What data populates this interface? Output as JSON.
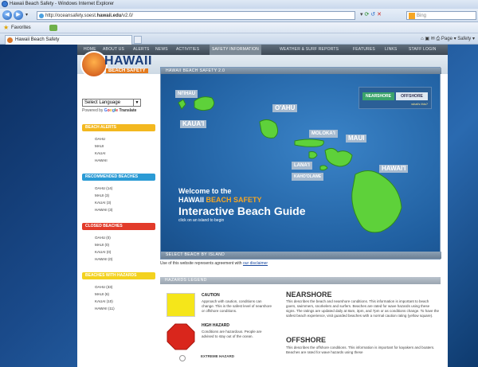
{
  "window": {
    "title": "Hawaii Beach Safety - Windows Internet Explorer",
    "url_prefix": "http://oceansafety.soest.",
    "url_domain": "hawaii.edu",
    "url_suffix": "/v2.0/",
    "search_placeholder": "Bing"
  },
  "favorites": {
    "label": "Favorites"
  },
  "tab": {
    "label": "Hawaii Beach Safety"
  },
  "command_bar": {
    "page": "Page ▾",
    "safety": "Safety ▾"
  },
  "nav": {
    "items": [
      "HOME",
      "ABOUT US",
      "ALERTS",
      "NEWS",
      "ACTIVITIES",
      "SAFETY INFORMATION",
      "WEATHER & SURF REPORTS",
      "FEATURES",
      "LINKS",
      "STAFF LOGIN"
    ]
  },
  "logo": {
    "word": "HAWAII",
    "sub": "BEACH SAFETY"
  },
  "sidebar": {
    "language_select": "Select Language",
    "powered_by": "Powered by",
    "translate": "Translate",
    "sections": [
      {
        "title": "BEACH ALERTS",
        "color": "#f3b81f",
        "items": [
          "OAHU",
          "MAUI",
          "KAUAI",
          "HAWAII"
        ]
      },
      {
        "title": "RECOMMENDED BEACHES",
        "color": "#2b9bd5",
        "items": [
          "OAHU (14)",
          "MAUI (3)",
          "KAUAI (3)",
          "HAWAII (3)"
        ]
      },
      {
        "title": "CLOSED BEACHES",
        "color": "#e23b2a",
        "items": [
          "OAHU (0)",
          "MAUI (0)",
          "KAUAI (0)",
          "HAWAII (0)"
        ]
      },
      {
        "title": "BEACHES WITH HAZARDS",
        "color": "#f3d21f",
        "items": [
          "OAHU (33)",
          "MAUI (6)",
          "KAUAI (10)",
          "HAWAII (11)"
        ]
      }
    ]
  },
  "map": {
    "title": "HAWAII BEACH SAFETY 2.0",
    "bottom_bar": "SELECT BEACH BY ISLAND",
    "toggle_nearshore": "NEARSHORE",
    "toggle_offshore": "OFFSHORE",
    "whats_this": "what's this?",
    "islands": {
      "niihau": "NI'IHAU",
      "kauai": "KAUA'I",
      "oahu": "O'AHU",
      "molokai": "MOLOKA'I",
      "maui": "MAUI",
      "lanai": "LANA'I",
      "kahoolawe": "KAHO'OLAWE",
      "hawaii": "HAWAI'I"
    },
    "welcome_line1": "Welcome to the",
    "welcome_line2a": "HAWAII",
    "welcome_line2b": "BEACH SAFETY",
    "welcome_line3": "Interactive Beach Guide",
    "welcome_line4": "click on an island to begin"
  },
  "disclaimer": {
    "text": "Use of this website represents agreement with",
    "link": "our disclaimer"
  },
  "hazard": {
    "title": "HAZARDS LEGEND",
    "caution_title": "CAUTION",
    "caution_text": "Approach with caution, conditions can change. This is the safest level of nearshore or offshore conditions.",
    "high_title": "HIGH HAZARD",
    "high_text": "Conditions are hazardous. People are advised to stay out of the ocean.",
    "extreme_title": "EXTREME HAZARD",
    "nearshore_title": "NEARSHORE",
    "nearshore_text": "This describes the beach and nearshore conditions. This information is important to beach goers, swimmers, snorkelers and surfers. Beaches are rated for wave hazards using these signs. The ratings are updated daily at 8am, 3pm, and 7pm or as conditions change. To have the safest beach experience, visit guarded beaches with a normal caution rating (yellow square).",
    "offshore_title": "OFFSHORE",
    "offshore_text": "This describes the offshore conditions. This information is important for kayakers and boaters. Beaches are rated for wave hazards using these"
  }
}
